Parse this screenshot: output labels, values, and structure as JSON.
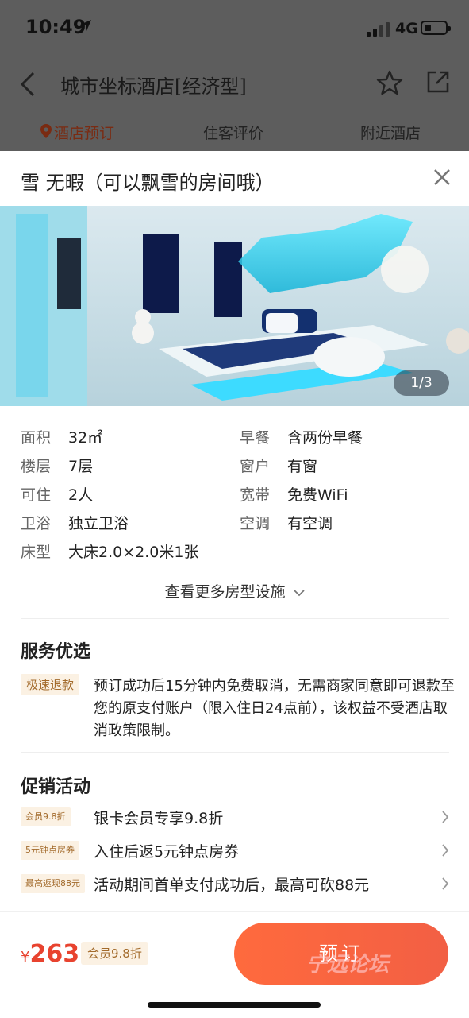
{
  "status": {
    "time": "10:49",
    "network": "4G"
  },
  "nav": {
    "title": "城市坐标酒店[经济型]"
  },
  "bg_tabs": [
    {
      "label": "酒店预订"
    },
    {
      "label": "住客评价"
    },
    {
      "label": "附近酒店"
    }
  ],
  "modal": {
    "title": "雪 无暇（可以飘雪的房间哦）",
    "photo_counter": "1/3"
  },
  "facilities": [
    {
      "key": "面积",
      "value": "32㎡"
    },
    {
      "key": "早餐",
      "value": "含两份早餐"
    },
    {
      "key": "楼层",
      "value": "7层"
    },
    {
      "key": "窗户",
      "value": "有窗"
    },
    {
      "key": "可住",
      "value": "2人"
    },
    {
      "key": "宽带",
      "value": "免费WiFi"
    },
    {
      "key": "卫浴",
      "value": "独立卫浴"
    },
    {
      "key": "空调",
      "value": "有空调"
    },
    {
      "key": "床型",
      "value": "大床2.0×2.0米1张"
    }
  ],
  "more_facilities": "查看更多房型设施",
  "service": {
    "title": "服务优选",
    "badge": "极速退款",
    "text": "预订成功后15分钟内免费取消，无需商家同意即可退款至您的原支付账户（限入住日24点前），该权益不受酒店取消政策限制。"
  },
  "promo": {
    "title": "促销活动",
    "items": [
      {
        "badge": "会员9.8折",
        "text": "银卡会员专享9.8折"
      },
      {
        "badge": "5元钟点房券",
        "text": "入住后返5元钟点房券"
      },
      {
        "badge": "最高返现88元",
        "text": "活动期间首单支付成功后，最高可砍88元"
      }
    ]
  },
  "bottom": {
    "currency": "¥",
    "price": "263",
    "member_badge": "会员9.8折",
    "book_label": "预订",
    "watermark": "宁远论坛"
  },
  "colors": {
    "accent": "#f25f44",
    "price": "#e8432f",
    "badge_bg": "#fbf1e3",
    "badge_text": "#a36b2c"
  }
}
